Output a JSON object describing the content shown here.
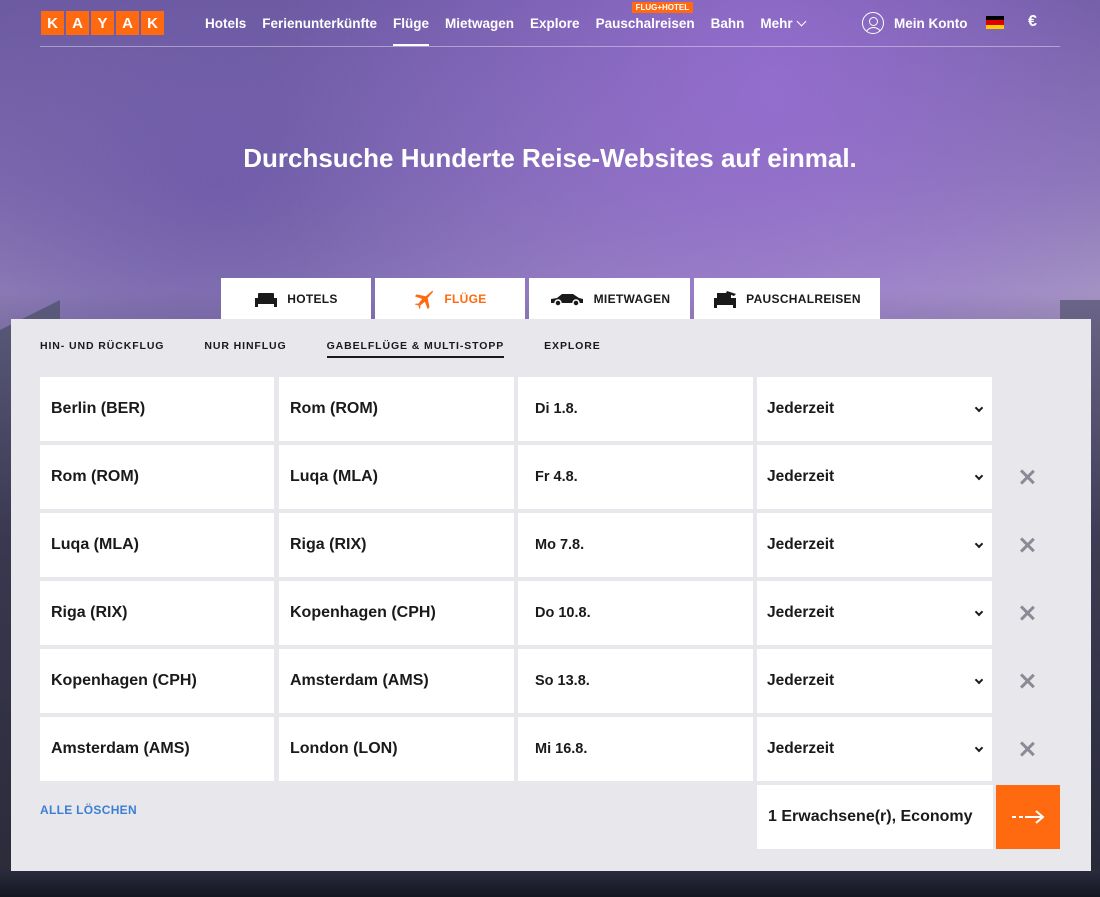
{
  "logo": {
    "letters": [
      "K",
      "A",
      "Y",
      "A",
      "K"
    ]
  },
  "nav": {
    "items": [
      {
        "label": "Hotels",
        "active": false
      },
      {
        "label": "Ferienunterkünfte",
        "active": false
      },
      {
        "label": "Flüge",
        "active": true
      },
      {
        "label": "Mietwagen",
        "active": false
      },
      {
        "label": "Explore",
        "active": false
      },
      {
        "label": "Pauschalreisen",
        "active": false,
        "badge": "FLUG+HOTEL"
      },
      {
        "label": "Bahn",
        "active": false
      },
      {
        "label": "Mehr",
        "active": false,
        "dropdown": true
      }
    ],
    "account_label": "Mein Konto",
    "account_icon": "user-circle-icon",
    "flag_colors": [
      "#000000",
      "#dd0000",
      "#ffce00"
    ],
    "currency": "€"
  },
  "hero": {
    "title": "Durchsuche Hunderte Reise-Websites auf einmal."
  },
  "product_tabs": [
    {
      "label": "HOTELS",
      "icon": "bed-icon",
      "active": false
    },
    {
      "label": "FLÜGE",
      "icon": "plane-icon",
      "active": true
    },
    {
      "label": "MIETWAGEN",
      "icon": "car-icon",
      "active": false
    },
    {
      "label": "PAUSCHALREISEN",
      "icon": "package-icon",
      "active": false
    }
  ],
  "search_tabs": [
    {
      "label": "HIN- UND RÜCKFLUG",
      "active": false
    },
    {
      "label": "NUR HINFLUG",
      "active": false
    },
    {
      "label": "GABELFLÜGE & MULTI-STOPP",
      "active": true
    },
    {
      "label": "EXPLORE",
      "active": false
    }
  ],
  "legs": [
    {
      "from": "Berlin (BER)",
      "to": "Rom (ROM)",
      "date": "Di 1.8.",
      "time": "Jederzeit",
      "removable": false
    },
    {
      "from": "Rom (ROM)",
      "to": "Luqa (MLA)",
      "date": "Fr 4.8.",
      "time": "Jederzeit",
      "removable": true
    },
    {
      "from": "Luqa (MLA)",
      "to": "Riga (RIX)",
      "date": "Mo 7.8.",
      "time": "Jederzeit",
      "removable": true
    },
    {
      "from": "Riga (RIX)",
      "to": "Kopenhagen (CPH)",
      "date": "Do 10.8.",
      "time": "Jederzeit",
      "removable": true
    },
    {
      "from": "Kopenhagen (CPH)",
      "to": "Amsterdam (AMS)",
      "date": "So 13.8.",
      "time": "Jederzeit",
      "removable": true
    },
    {
      "from": "Amsterdam (AMS)",
      "to": "London (LON)",
      "date": "Mi 16.8.",
      "time": "Jederzeit",
      "removable": true
    }
  ],
  "clear_all_label": "ALLE LÖSCHEN",
  "travelers_label": "1 Erwachsene(r), Economy",
  "search_button_icon": "arrow-right-icon",
  "colors": {
    "accent": "#ff690f",
    "link": "#3d7fd4",
    "panel": "#e7e7ec"
  }
}
